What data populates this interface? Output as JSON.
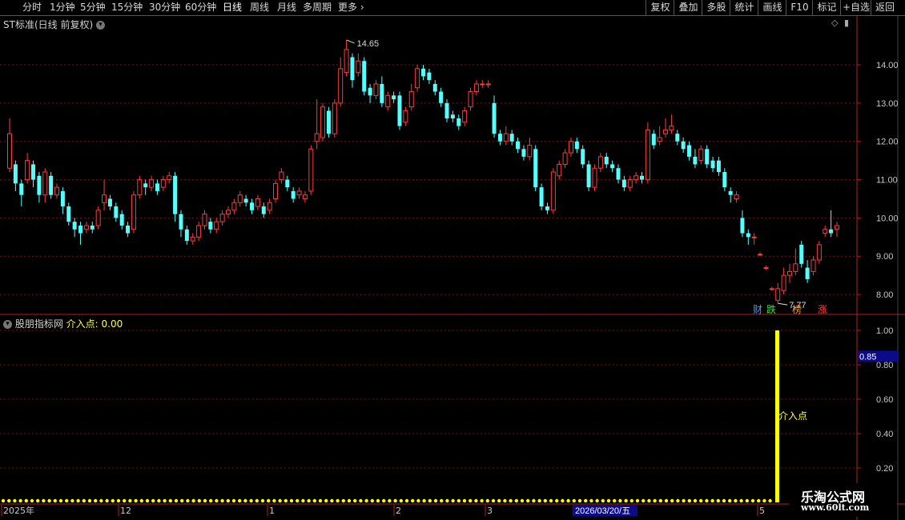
{
  "toolbar": {
    "periods": [
      "分时",
      "1分钟",
      "5分钟",
      "15分钟",
      "30分钟",
      "60分钟",
      "日线",
      "周线",
      "月线",
      "多周期",
      "更多"
    ],
    "active_period": "日线",
    "right_buttons": [
      "复权",
      "叠加",
      "多股",
      "统计",
      "画线",
      "F10",
      "标记",
      "+自选",
      "返回"
    ]
  },
  "main_title": "ST标准(日线 前复权)",
  "main_panel": {
    "price_ticks": [
      "14.00",
      "13.00",
      "12.00",
      "11.00",
      "10.00",
      "9.00",
      "8.00"
    ],
    "high_label": "14.65",
    "low_label": "7.77",
    "markers": [
      {
        "text": "财",
        "color": "#3aa0ff"
      },
      {
        "text": "跌",
        "color": "#40e040"
      },
      {
        "text": "榜",
        "color": "#ff9933"
      },
      {
        "text": "涨",
        "color": "#ff4040"
      }
    ]
  },
  "sub_panel": {
    "title": "股朋指标网",
    "indicator_label": "介入点:",
    "indicator_value": "0.00",
    "ticks": [
      "1.00",
      "0.80",
      "0.60",
      "0.40",
      "0.20"
    ],
    "current_value": "0.85",
    "signal_label": "介入点"
  },
  "x_axis": {
    "labels": [
      "2025年",
      "12",
      "1",
      "2",
      "3",
      "2026/03/20/五",
      "5"
    ]
  },
  "watermark": {
    "line1": "乐淘公式网",
    "line2": "www.60lt.com"
  },
  "chart_data": {
    "type": "candlestick",
    "ylim": [
      7.5,
      14.9
    ],
    "candles": [
      [
        11.3,
        12.2,
        11.2,
        12.6
      ],
      [
        11.4,
        10.9,
        10.7,
        11.5
      ],
      [
        10.9,
        10.6,
        10.3,
        11.0
      ],
      [
        11.0,
        11.5,
        10.9,
        11.7
      ],
      [
        11.4,
        11.0,
        10.8,
        11.5
      ],
      [
        11.1,
        10.6,
        10.4,
        11.2
      ],
      [
        10.6,
        11.2,
        10.4,
        11.3
      ],
      [
        11.1,
        10.6,
        10.5,
        11.2
      ],
      [
        10.6,
        10.8,
        10.5,
        10.9
      ],
      [
        10.7,
        10.3,
        10.1,
        10.8
      ],
      [
        10.3,
        9.9,
        9.8,
        10.4
      ],
      [
        9.9,
        9.7,
        9.5,
        10.0
      ],
      [
        9.8,
        9.6,
        9.3,
        9.9
      ],
      [
        9.7,
        9.8,
        9.6,
        9.9
      ],
      [
        9.8,
        9.7,
        9.6,
        9.9
      ],
      [
        9.8,
        10.2,
        9.7,
        10.3
      ],
      [
        10.4,
        10.6,
        10.2,
        11.0
      ],
      [
        10.5,
        10.3,
        10.2,
        10.6
      ],
      [
        10.3,
        10.0,
        9.9,
        10.4
      ],
      [
        10.1,
        9.8,
        9.7,
        10.2
      ],
      [
        9.8,
        9.6,
        9.5,
        9.9
      ],
      [
        9.7,
        10.6,
        9.6,
        10.7
      ],
      [
        10.6,
        11.0,
        10.5,
        11.1
      ],
      [
        10.9,
        10.8,
        10.6,
        11.0
      ],
      [
        10.8,
        11.0,
        10.7,
        11.1
      ],
      [
        10.9,
        10.7,
        10.6,
        11.0
      ],
      [
        10.8,
        11.0,
        10.7,
        11.1
      ],
      [
        11.0,
        11.1,
        10.9,
        11.2
      ],
      [
        11.1,
        10.1,
        9.9,
        11.2
      ],
      [
        10.1,
        9.7,
        9.5,
        10.2
      ],
      [
        9.7,
        9.4,
        9.3,
        9.8
      ],
      [
        9.4,
        9.5,
        9.3,
        9.6
      ],
      [
        9.5,
        9.8,
        9.4,
        9.9
      ],
      [
        9.8,
        10.1,
        9.7,
        10.2
      ],
      [
        9.9,
        9.7,
        9.6,
        10.0
      ],
      [
        9.7,
        9.9,
        9.6,
        10.0
      ],
      [
        9.9,
        10.1,
        9.8,
        10.2
      ],
      [
        10.1,
        10.2,
        10.0,
        10.3
      ],
      [
        10.2,
        10.4,
        10.1,
        10.5
      ],
      [
        10.4,
        10.6,
        10.3,
        10.7
      ],
      [
        10.5,
        10.4,
        10.3,
        10.6
      ],
      [
        10.4,
        10.2,
        10.1,
        10.5
      ],
      [
        10.3,
        10.5,
        10.2,
        10.6
      ],
      [
        10.3,
        10.1,
        10.0,
        10.4
      ],
      [
        10.2,
        10.4,
        10.1,
        10.5
      ],
      [
        10.5,
        10.9,
        10.4,
        11.0
      ],
      [
        11.0,
        11.2,
        10.9,
        11.3
      ],
      [
        11.0,
        10.8,
        10.7,
        11.1
      ],
      [
        10.7,
        10.5,
        10.4,
        10.8
      ],
      [
        10.6,
        10.7,
        10.5,
        10.8
      ],
      [
        10.5,
        10.6,
        10.4,
        10.7
      ],
      [
        10.7,
        11.8,
        10.6,
        11.9
      ],
      [
        12.0,
        12.2,
        11.8,
        13.1
      ],
      [
        12.1,
        12.9,
        12.0,
        13.0
      ],
      [
        12.8,
        12.2,
        12.1,
        12.9
      ],
      [
        12.2,
        13.0,
        12.1,
        13.1
      ],
      [
        13.0,
        13.9,
        12.9,
        14.2
      ],
      [
        13.8,
        14.4,
        13.7,
        14.65
      ],
      [
        14.2,
        13.6,
        13.4,
        14.3
      ],
      [
        13.8,
        14.1,
        13.7,
        14.3
      ],
      [
        14.1,
        13.3,
        13.2,
        14.2
      ],
      [
        13.4,
        13.2,
        13.0,
        13.5
      ],
      [
        13.2,
        13.5,
        13.1,
        13.6
      ],
      [
        13.5,
        13.0,
        12.9,
        13.7
      ],
      [
        12.9,
        13.2,
        12.8,
        13.3
      ],
      [
        13.2,
        13.1,
        13.0,
        13.3
      ],
      [
        13.2,
        12.4,
        12.3,
        13.3
      ],
      [
        12.5,
        12.8,
        12.4,
        12.9
      ],
      [
        12.9,
        13.3,
        12.8,
        13.5
      ],
      [
        13.4,
        13.9,
        13.3,
        14.0
      ],
      [
        13.9,
        13.7,
        13.6,
        14.0
      ],
      [
        13.8,
        13.6,
        13.5,
        13.9
      ],
      [
        13.5,
        13.3,
        13.2,
        13.6
      ],
      [
        13.3,
        13.0,
        12.9,
        13.4
      ],
      [
        13.0,
        12.6,
        12.5,
        13.1
      ],
      [
        12.7,
        12.6,
        12.5,
        12.8
      ],
      [
        12.6,
        12.4,
        12.3,
        12.7
      ],
      [
        12.5,
        12.8,
        12.4,
        12.9
      ],
      [
        12.9,
        13.3,
        12.8,
        13.4
      ],
      [
        13.3,
        13.5,
        13.2,
        13.6
      ],
      [
        13.5,
        13.5,
        13.4,
        13.6
      ],
      [
        13.5,
        13.5,
        13.4,
        13.6
      ],
      [
        13.0,
        12.2,
        12.1,
        13.2
      ],
      [
        12.2,
        12.0,
        11.9,
        12.3
      ],
      [
        12.0,
        12.2,
        11.9,
        12.4
      ],
      [
        12.2,
        12.0,
        11.9,
        12.3
      ],
      [
        12.0,
        11.8,
        11.7,
        12.1
      ],
      [
        11.8,
        11.6,
        11.5,
        11.9
      ],
      [
        11.6,
        11.9,
        11.5,
        12.1
      ],
      [
        11.8,
        10.8,
        10.7,
        11.9
      ],
      [
        10.8,
        10.3,
        10.2,
        10.9
      ],
      [
        10.3,
        10.2,
        10.1,
        10.4
      ],
      [
        10.2,
        11.2,
        10.1,
        11.3
      ],
      [
        11.1,
        11.4,
        11.0,
        11.5
      ],
      [
        11.4,
        11.7,
        11.3,
        11.8
      ],
      [
        11.7,
        12.0,
        11.6,
        12.1
      ],
      [
        12.0,
        11.8,
        11.7,
        12.1
      ],
      [
        11.8,
        11.4,
        11.3,
        11.9
      ],
      [
        11.4,
        10.8,
        10.7,
        11.5
      ],
      [
        10.8,
        11.3,
        10.7,
        11.4
      ],
      [
        11.3,
        11.6,
        11.2,
        11.7
      ],
      [
        11.6,
        11.4,
        11.3,
        11.7
      ],
      [
        11.4,
        11.3,
        11.2,
        11.5
      ],
      [
        11.3,
        11.0,
        10.9,
        11.4
      ],
      [
        11.0,
        10.8,
        10.7,
        11.1
      ],
      [
        10.8,
        11.0,
        10.7,
        11.1
      ],
      [
        11.0,
        11.1,
        10.9,
        11.2
      ],
      [
        11.1,
        11.0,
        10.9,
        11.2
      ],
      [
        11.0,
        12.3,
        10.9,
        12.5
      ],
      [
        12.2,
        11.9,
        11.8,
        12.3
      ],
      [
        12.0,
        12.1,
        11.9,
        12.4
      ],
      [
        12.2,
        12.3,
        12.1,
        12.6
      ],
      [
        12.3,
        12.4,
        12.2,
        12.7
      ],
      [
        12.2,
        12.0,
        11.9,
        12.3
      ],
      [
        12.0,
        11.8,
        11.7,
        12.1
      ],
      [
        11.9,
        11.6,
        11.5,
        12.0
      ],
      [
        11.6,
        11.4,
        11.3,
        11.8
      ],
      [
        11.5,
        11.8,
        11.4,
        11.9
      ],
      [
        11.8,
        11.4,
        11.3,
        11.9
      ],
      [
        11.5,
        11.3,
        11.2,
        11.6
      ],
      [
        11.5,
        11.2,
        11.1,
        11.6
      ],
      [
        11.2,
        10.8,
        10.7,
        11.3
      ],
      [
        10.7,
        10.6,
        10.4,
        10.8
      ],
      [
        10.5,
        10.6,
        10.4,
        10.7
      ],
      [
        10.0,
        9.6,
        9.5,
        10.2
      ],
      [
        9.6,
        9.5,
        9.3,
        9.7
      ],
      [
        9.5,
        9.5,
        9.3,
        9.6
      ],
      [
        9.05,
        9.05,
        9.0,
        9.1
      ],
      [
        8.7,
        8.7,
        8.65,
        8.75
      ],
      [
        8.15,
        8.15,
        8.1,
        8.2
      ],
      [
        7.85,
        8.15,
        7.77,
        8.3
      ],
      [
        8.1,
        8.5,
        8.0,
        8.7
      ],
      [
        8.5,
        8.6,
        8.3,
        8.8
      ],
      [
        8.6,
        8.8,
        8.5,
        9.2
      ],
      [
        9.3,
        8.8,
        8.7,
        9.4
      ],
      [
        8.7,
        8.4,
        8.3,
        8.9
      ],
      [
        8.6,
        8.9,
        8.5,
        9.0
      ],
      [
        8.9,
        9.3,
        8.8,
        9.4
      ],
      [
        9.6,
        9.7,
        9.5,
        9.8
      ],
      [
        9.7,
        9.6,
        9.5,
        10.2
      ],
      [
        9.7,
        9.8,
        9.5,
        9.9
      ]
    ]
  }
}
